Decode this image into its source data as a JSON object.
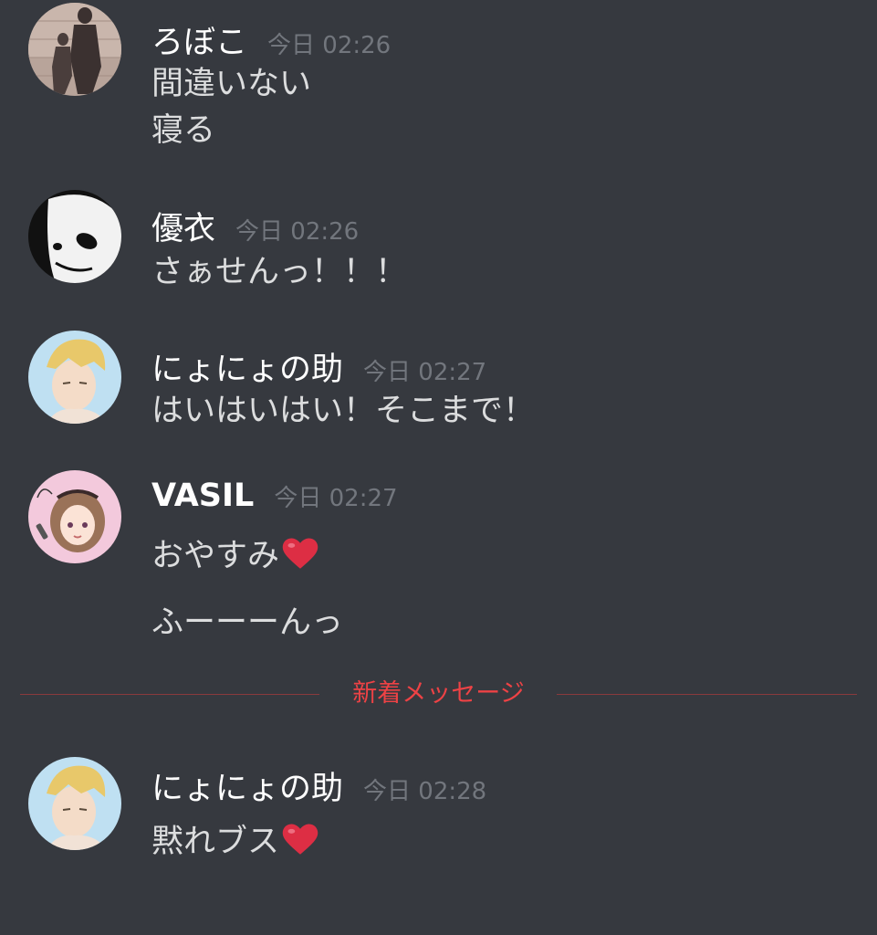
{
  "messages": [
    {
      "author": "ろぼこ",
      "timestamp": "今日 02:26",
      "lines": [
        "間違いない",
        "寝る"
      ]
    },
    {
      "author": "優衣",
      "timestamp": "今日 02:26",
      "lines": [
        "さぁせんっ！！！"
      ]
    },
    {
      "author": "にょにょの助",
      "timestamp": "今日 02:27",
      "lines": [
        "はいはいはい！そこまで！"
      ]
    },
    {
      "author": "VASIL",
      "timestamp": "今日 02:27",
      "lines": [
        "おやすみ",
        "ふーーーんっ"
      ]
    },
    {
      "author": "にょにょの助",
      "timestamp": "今日 02:28",
      "lines": [
        "黙れブス"
      ]
    }
  ],
  "new_messages_divider": "新着メッセージ",
  "colors": {
    "background": "#36393f",
    "author": "#ffffff",
    "timestamp": "#72767d",
    "message_text": "#dcddde",
    "new_divider": "#ed4245"
  },
  "icons": {
    "heart": "red-heart-emoji"
  }
}
